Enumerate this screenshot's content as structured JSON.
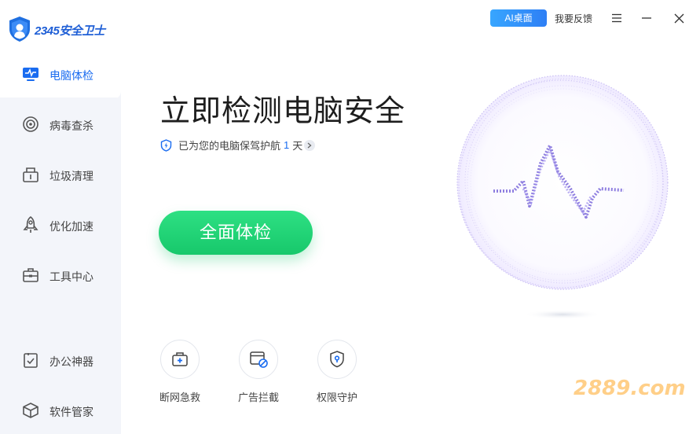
{
  "app": {
    "logo_text": "2345安全卫士"
  },
  "topbar": {
    "ai_button": "AI桌面",
    "feedback": "我要反馈"
  },
  "sidebar": {
    "items": [
      {
        "label": "电脑体检",
        "icon": "monitor-pulse-icon",
        "active": true
      },
      {
        "label": "病毒查杀",
        "icon": "target-icon"
      },
      {
        "label": "垃圾清理",
        "icon": "trash-box-icon"
      },
      {
        "label": "优化加速",
        "icon": "rocket-icon"
      },
      {
        "label": "工具中心",
        "icon": "toolbox-icon"
      },
      {
        "label": "办公神器",
        "icon": "checklist-icon"
      },
      {
        "label": "软件管家",
        "icon": "cube-icon"
      }
    ]
  },
  "main": {
    "title": "立即检测电脑安全",
    "protect_prefix": "已为您的电脑保驾护航",
    "protect_days": "1",
    "protect_suffix": "天",
    "check_button": "全面体检",
    "tools": [
      {
        "label": "断网急救",
        "icon": "first-aid-kit-icon"
      },
      {
        "label": "广告拦截",
        "icon": "ad-block-icon"
      },
      {
        "label": "权限守护",
        "icon": "shield-lock-icon"
      }
    ]
  },
  "watermark": "2889.com",
  "colors": {
    "accent": "#1a6cf0",
    "green": "#17c86b",
    "sidebar_bg": "#f3f5fa",
    "orb": "#8f7fe0"
  }
}
